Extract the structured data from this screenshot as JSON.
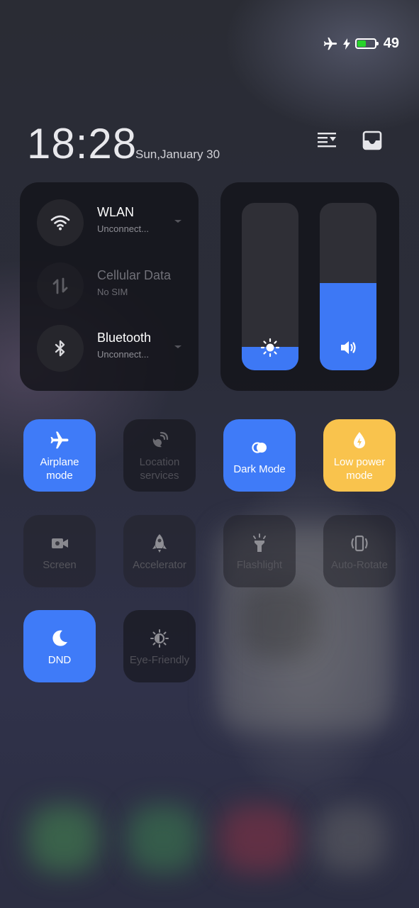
{
  "status_bar": {
    "airplane_icon": "airplane-icon",
    "charging_icon": "bolt-icon",
    "battery_level": "49",
    "battery_fraction": 0.49,
    "battery_color": "#28d22a"
  },
  "header": {
    "time": "18:28",
    "date": "Sun,January 30",
    "edit_icon": "edit-list-icon",
    "notifications_icon": "inbox-icon"
  },
  "connectivity": [
    {
      "name": "WLAN",
      "status": "Unconnect...",
      "icon": "wifi-icon",
      "enabled": true,
      "has_menu": true
    },
    {
      "name": "Cellular Data",
      "status": "No SIM",
      "icon": "cellular-data-icon",
      "enabled": false,
      "has_menu": false
    },
    {
      "name": "Bluetooth",
      "status": "Unconnect...",
      "icon": "bluetooth-icon",
      "enabled": true,
      "has_menu": true
    }
  ],
  "sliders": {
    "brightness": {
      "icon": "sun-icon",
      "level": 0.14
    },
    "volume": {
      "icon": "speaker-icon",
      "level": 0.52
    },
    "accent": "#3d78f5"
  },
  "tiles": [
    {
      "label": "Airplane mode",
      "label_lines": [
        "Airplane",
        "mode"
      ],
      "icon": "airplane-icon",
      "state": "on",
      "color": "#3f7bf8"
    },
    {
      "label": "Location services",
      "label_lines": [
        "Location",
        "services"
      ],
      "icon": "location-icon",
      "state": "off"
    },
    {
      "label": "Dark Mode",
      "label_lines": [
        "Dark Mode"
      ],
      "icon": "dark-mode-icon",
      "state": "on",
      "color": "#3f7bf8"
    },
    {
      "label": "Low power mode",
      "label_lines": [
        "Low power",
        "mode"
      ],
      "icon": "power-saver-icon",
      "state": "on",
      "color": "#f9c34d"
    },
    {
      "label": "Screen",
      "label_lines": [
        "Screen"
      ],
      "icon": "screen-record-icon",
      "state": "off"
    },
    {
      "label": "Accelerator",
      "label_lines": [
        "Accelerator"
      ],
      "icon": "rocket-icon",
      "state": "off"
    },
    {
      "label": "Flashlight",
      "label_lines": [
        "Flashlight"
      ],
      "icon": "flashlight-icon",
      "state": "off"
    },
    {
      "label": "Auto-Rotate",
      "label_lines": [
        "Auto-Rotate"
      ],
      "icon": "auto-rotate-icon",
      "state": "off"
    },
    {
      "label": "DND",
      "label_lines": [
        "DND"
      ],
      "icon": "moon-icon",
      "state": "on",
      "color": "#3f7bf8"
    },
    {
      "label": "Eye-Friendly",
      "label_lines": [
        "Eye-Friendly"
      ],
      "icon": "eye-comfort-icon",
      "state": "off"
    }
  ]
}
